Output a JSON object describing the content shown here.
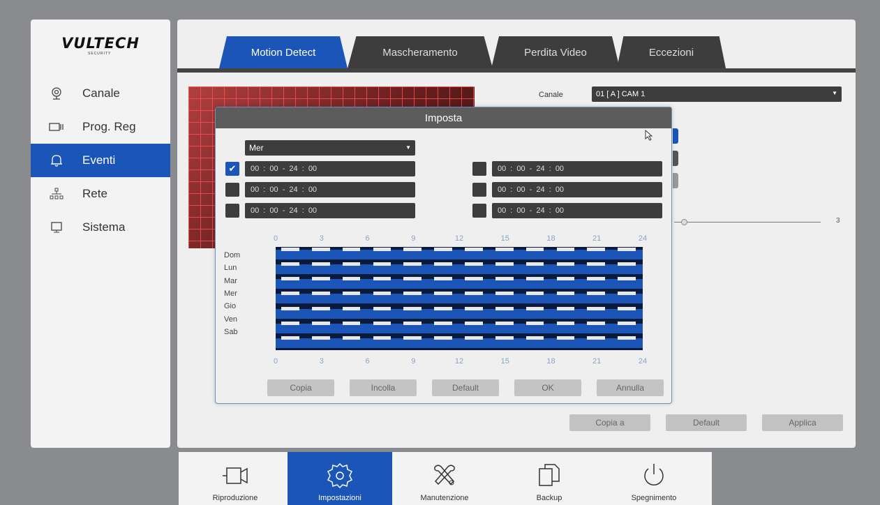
{
  "brand": {
    "logo": "VULTECH",
    "logo_sub": "SECURITY"
  },
  "sidebar": {
    "items": [
      {
        "label": "Canale",
        "icon": "camera-icon",
        "active": false
      },
      {
        "label": "Prog. Reg",
        "icon": "recorder-icon",
        "active": false
      },
      {
        "label": "Eventi",
        "icon": "bell-icon",
        "active": true
      },
      {
        "label": "Rete",
        "icon": "network-icon",
        "active": false
      },
      {
        "label": "Sistema",
        "icon": "monitor-icon",
        "active": false
      }
    ]
  },
  "tabs": [
    {
      "label": "Motion Detect",
      "active": true
    },
    {
      "label": "Mascheramento",
      "active": false
    },
    {
      "label": "Perdita Video",
      "active": false
    },
    {
      "label": "Eccezioni",
      "active": false
    }
  ],
  "main": {
    "canale_label": "Canale",
    "canale_value": "01 [ A ] CAM 1",
    "slider_value": "3",
    "buttons": {
      "copy_to": "Copia a",
      "default": "Default",
      "apply": "Applica"
    }
  },
  "modal": {
    "title": "Imposta",
    "day_selected": "Mer",
    "periods": [
      {
        "checked": true,
        "value": "00 : 00  - 24 : 00"
      },
      {
        "checked": false,
        "value": "00 : 00  - 24 : 00"
      },
      {
        "checked": false,
        "value": "00 : 00  - 24 : 00"
      },
      {
        "checked": false,
        "value": "00 : 00  - 24 : 00"
      },
      {
        "checked": false,
        "value": "00 : 00  - 24 : 00"
      },
      {
        "checked": false,
        "value": "00 : 00  - 24 : 00"
      }
    ],
    "hour_ticks": [
      "0",
      "3",
      "6",
      "9",
      "12",
      "15",
      "18",
      "21",
      "24"
    ],
    "days": [
      "Dom",
      "Lun",
      "Mar",
      "Mer",
      "Gio",
      "Ven",
      "Sab"
    ],
    "buttons": {
      "copy": "Copia",
      "paste": "Incolla",
      "default": "Default",
      "ok": "OK",
      "cancel": "Annulla"
    }
  },
  "dock": {
    "items": [
      {
        "label": "Riproduzione",
        "icon": "playback-camera-icon",
        "active": false
      },
      {
        "label": "Impostazioni",
        "icon": "settings-gear-icon",
        "active": true
      },
      {
        "label": "Manutenzione",
        "icon": "tools-icon",
        "active": false
      },
      {
        "label": "Backup",
        "icon": "backup-files-icon",
        "active": false
      },
      {
        "label": "Spegnimento",
        "icon": "power-icon",
        "active": false
      }
    ]
  },
  "colors": {
    "accent": "#1b55b8",
    "dark": "#3d3d3d",
    "panel": "#efefef"
  }
}
